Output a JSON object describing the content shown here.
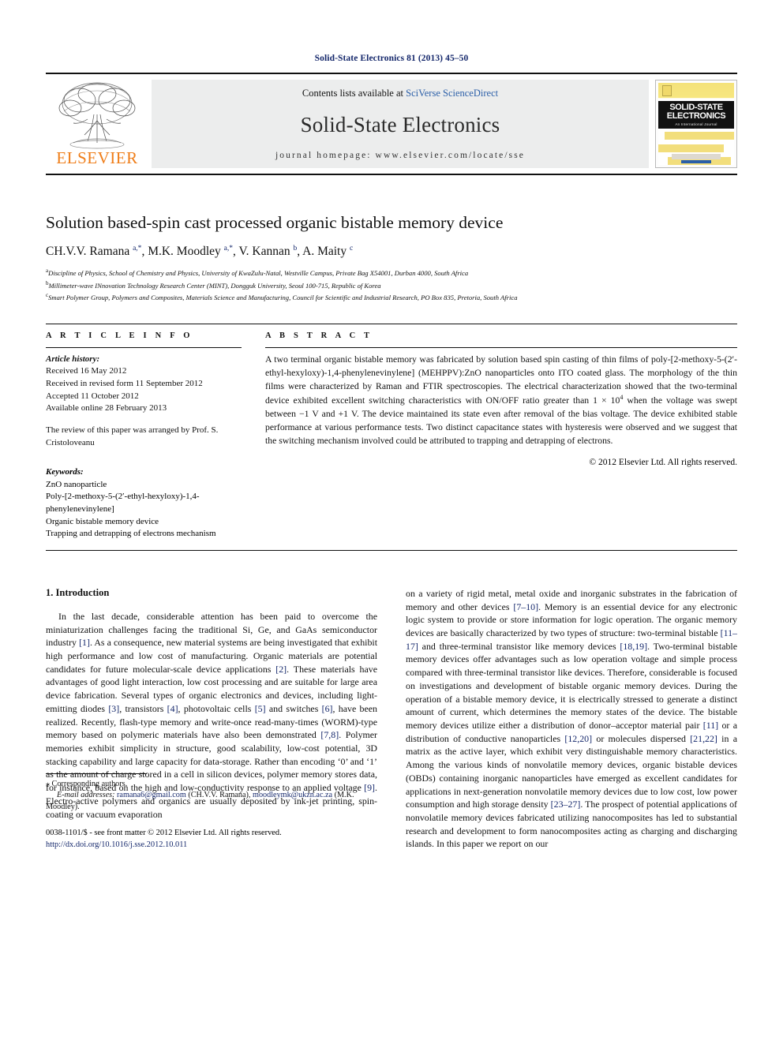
{
  "running_head": "Solid-State Electronics 81 (2013) 45–50",
  "masthead": {
    "contents_prefix": "Contents lists available at ",
    "contents_link": "SciVerse ScienceDirect",
    "journal_title": "Solid-State Electronics",
    "homepage": "journal homepage: www.elsevier.com/locate/sse",
    "publisher_logo_text": "ELSEVIER",
    "publisher_logo_icon": "elsevier-tree-icon",
    "cover": {
      "line1": "SOLID-STATE",
      "line2": "ELECTRONICS",
      "subtitle": "An International Journal"
    }
  },
  "article": {
    "title": "Solution based-spin cast processed organic bistable memory device",
    "authors_html": "CH.V.V. Ramana <sup>a,*</sup>, M.K. Moodley <sup>a,*</sup>, V. Kannan <sup>b</sup>, A. Maity <sup>c</sup>",
    "affiliations": [
      {
        "mark": "a",
        "text": "Discipline of Physics, School of Chemistry and Physics, University of KwaZulu-Natal, Westville Campus, Private Bag X54001, Durban 4000, South Africa"
      },
      {
        "mark": "b",
        "text": "Millimeter-wave INnovation Technology Research Center (MINT), Dongguk University, Seoul 100-715, Republic of Korea"
      },
      {
        "mark": "c",
        "text": "Smart Polymer Group, Polymers and Composites, Materials Science and Manufacturing, Council for Scientific and Industrial Research, PO Box 835, Pretoria, South Africa"
      }
    ]
  },
  "article_info": {
    "heading": "A R T I C L E    I N F O",
    "history_label": "Article history:",
    "history": [
      "Received 16 May 2012",
      "Received in revised form 11 September 2012",
      "Accepted 11 October 2012",
      "Available online 28 February 2013"
    ],
    "editor_note": "The review of this paper was arranged by Prof. S. Cristoloveanu",
    "keywords_label": "Keywords:",
    "keywords": [
      "ZnO nanoparticle",
      "Poly-[2-methoxy-5-(2′-ethyl-hexyloxy)-1,4-phenylenevinylene]",
      "Organic bistable memory device",
      "Trapping and detrapping of electrons mechanism"
    ]
  },
  "abstract": {
    "heading": "A B S T R A C T",
    "text_part1": "A two terminal organic bistable memory was fabricated by solution based spin casting of thin films of poly-[2-methoxy-5-(2′-ethyl-hexyloxy)-1,4-phenylenevinylene] (MEHPPV):ZnO nanoparticles onto ITO coated glass. The morphology of the thin films were characterized by Raman and FTIR spectroscopies. The electrical characterization showed that the two-terminal device exhibited excellent switching characteristics with ON/OFF ratio greater than 1 × 10",
    "exponent": "4",
    "text_part2": " when the voltage was swept between −1 V and +1 V. The device maintained its state even after removal of the bias voltage. The device exhibited stable performance at various performance tests. Two distinct capacitance states with hysteresis were observed and we suggest that the switching mechanism involved could be attributed to trapping and detrapping of electrons.",
    "copyright": "© 2012 Elsevier Ltd. All rights reserved."
  },
  "introduction": {
    "heading": "1. Introduction",
    "left_paragraph": "In the last decade, considerable attention has been paid to overcome the miniaturization challenges facing the traditional Si, Ge, and GaAs semiconductor industry [1]. As a consequence, new material systems are being investigated that exhibit high performance and low cost of manufacturing. Organic materials are potential candidates for future molecular-scale device applications [2]. These materials have advantages of good light interaction, low cost processing and are suitable for large area device fabrication. Several types of organic electronics and devices, including light-emitting diodes [3], transistors [4], photovoltaic cells [5] and switches [6], have been realized. Recently, flash-type memory and write-once read-many-times (WORM)-type memory based on polymeric materials have also been demonstrated [7,8]. Polymer memories exhibit simplicity in structure, good scalability, low-cost potential, 3D stacking capability and large capacity for data-storage. Rather than encoding ‘0’ and ‘1’ as the amount of charge stored in a cell in silicon devices, polymer memory stores data, for instance, based on the high and low-conductivity response to an applied voltage [9]. Electro-active polymers and organics are usually deposited by ink-jet printing, spin-coating or vacuum evaporation",
    "right_paragraph": "on a variety of rigid metal, metal oxide and inorganic substrates in the fabrication of memory and other devices [7–10]. Memory is an essential device for any electronic logic system to provide or store information for logic operation. The organic memory devices are basically characterized by two types of structure: two-terminal bistable [11–17] and three-terminal transistor like memory devices [18,19]. Two-terminal bistable memory devices offer advantages such as low operation voltage and simple process compared with three-terminal transistor like devices. Therefore, considerable is focused on investigations and development of bistable organic memory devices. During the operation of a bistable memory device, it is electrically stressed to generate a distinct amount of current, which determines the memory states of the device. The bistable memory devices utilize either a distribution of donor–acceptor material pair [11] or a distribution of conductive nanoparticles [12,20] or molecules dispersed [21,22] in a matrix as the active layer, which exhibit very distinguishable memory characteristics. Among the various kinds of nonvolatile memory devices, organic bistable devices (OBDs) containing inorganic nanoparticles have emerged as excellent candidates for applications in next-generation nonvolatile memory devices due to low cost, low power consumption and high storage density [23–27]. The prospect of potential applications of nonvolatile memory devices fabricated utilizing nanocomposites has led to substantial research and development to form nanocomposites acting as charging and discharging islands. In this paper we report on our"
  },
  "footnotes": {
    "corresponding": "Corresponding authors.",
    "corresponding_mark": "⁎",
    "email_label": "E-mail addresses:",
    "email_1": "ramana6@gmail.com",
    "email_1_owner": " (CH.V.V. Ramana), ",
    "email_2": "moodleymk@ukzn.ac.za",
    "email_2_owner": " (M.K. Moodley).",
    "issn_line": "0038-1101/$ - see front matter © 2012 Elsevier Ltd. All rights reserved.",
    "doi_link": "http://dx.doi.org/10.1016/j.sse.2012.10.011"
  },
  "colors": {
    "link_blue": "#14276b",
    "sd_blue": "#2b5fa8",
    "elsevier_orange": "#ef7d18",
    "masthead_gray": "#eceded"
  }
}
